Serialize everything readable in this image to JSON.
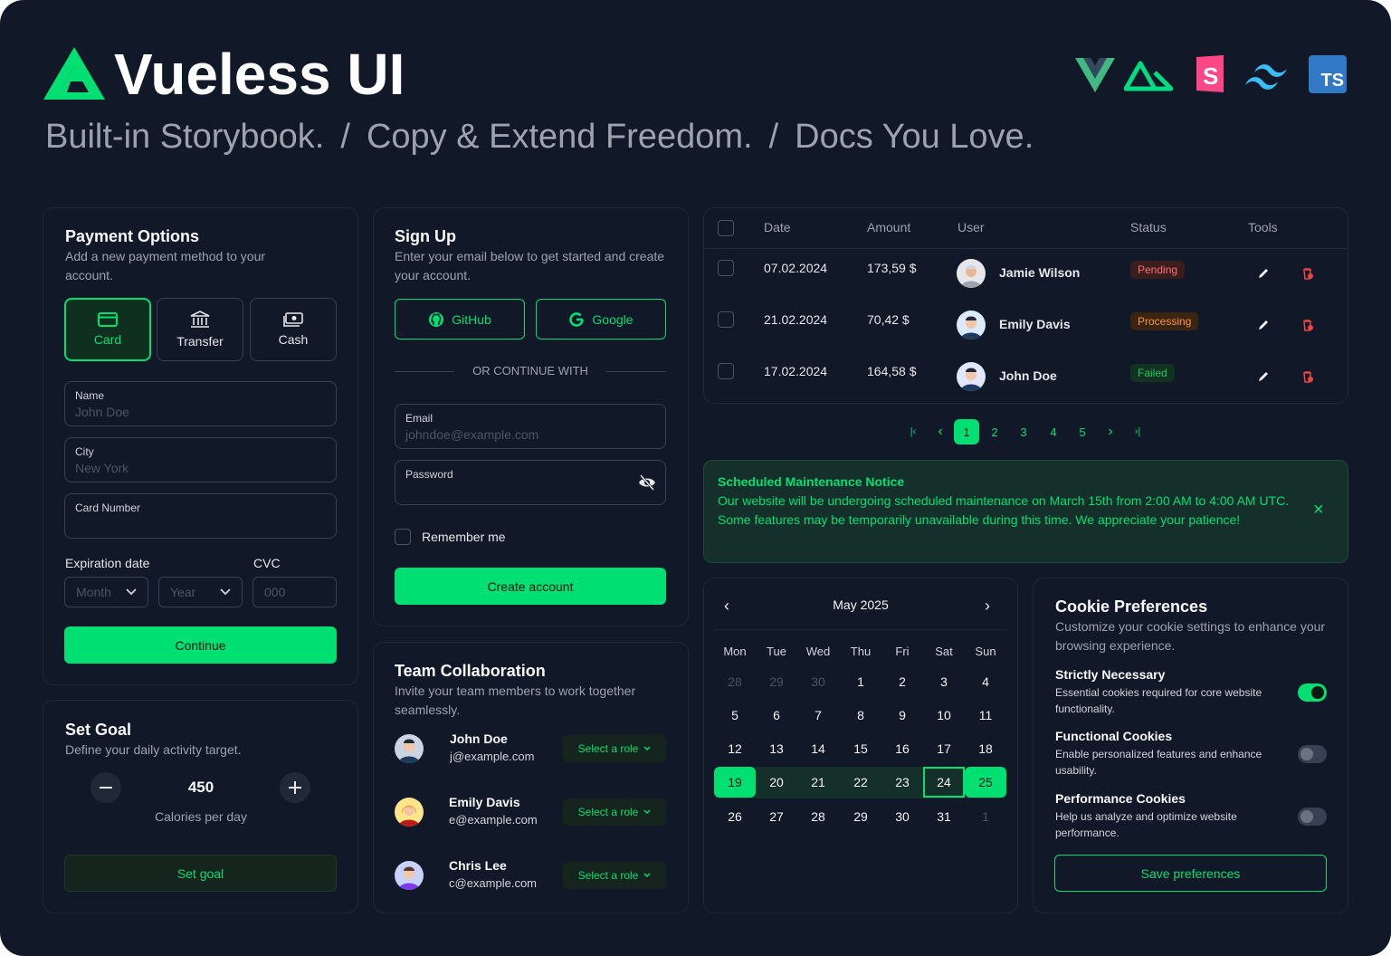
{
  "header": {
    "brand": "Vueless UI",
    "taglines": [
      "Built-in Storybook.",
      "/",
      "Copy & Extend Freedom.",
      "/",
      "Docs You Love."
    ],
    "tech_icons": [
      "vue-icon",
      "nuxt-icon",
      "storybook-icon",
      "tailwind-icon",
      "typescript-icon"
    ],
    "ts_label": "TS"
  },
  "payment": {
    "title": "Payment Options",
    "subtitle": "Add a new payment method to your account.",
    "methods": [
      {
        "label": "Card",
        "icon": "credit-card-icon",
        "active": true
      },
      {
        "label": "Transfer",
        "icon": "bank-icon",
        "active": false
      },
      {
        "label": "Cash",
        "icon": "cash-icon",
        "active": false
      }
    ],
    "name_label": "Name",
    "name_placeholder": "John Doe",
    "city_label": "City",
    "city_placeholder": "New York",
    "card_label": "Card Number",
    "card_placeholder": "",
    "exp_label": "Expiration date",
    "cvc_label": "CVC",
    "month_placeholder": "Month",
    "year_placeholder": "Year",
    "cvc_placeholder": "000",
    "continue_label": "Continue"
  },
  "goal": {
    "title": "Set Goal",
    "subtitle": "Define your daily activity target.",
    "value": "450",
    "unit": "Calories per day",
    "button": "Set goal"
  },
  "signup": {
    "title": "Sign Up",
    "subtitle": "Enter your email below to get started and create your account.",
    "github": "GitHub",
    "google": "Google",
    "divider": "OR CONTINUE WITH",
    "email_label": "Email",
    "email_placeholder": "johndoe@example.com",
    "password_label": "Password",
    "remember": "Remember me",
    "create": "Create account"
  },
  "team": {
    "title": "Team Collaboration",
    "subtitle": "Invite your team members to work together seamlessly.",
    "select_label": "Select a role",
    "members": [
      {
        "name": "John Doe",
        "email": "j@example.com"
      },
      {
        "name": "Emily Davis",
        "email": "e@example.com"
      },
      {
        "name": "Chris Lee",
        "email": "c@example.com"
      }
    ]
  },
  "table": {
    "headers": {
      "date": "Date",
      "amount": "Amount",
      "user": "User",
      "status": "Status",
      "tools": "Tools"
    },
    "rows": [
      {
        "date": "07.02.2024",
        "amount": "173,59 $",
        "user": "Jamie Wilson",
        "status": "Pending",
        "status_color": "#f87171"
      },
      {
        "date": "21.02.2024",
        "amount": "70,42 $",
        "user": "Emily Davis",
        "status": "Processing",
        "status_color": "#fb923c"
      },
      {
        "date": "17.02.2024",
        "amount": "164,58 $",
        "user": "John Doe",
        "status": "Failed",
        "status_color": "#22c55e"
      }
    ]
  },
  "pagination": {
    "first": "|‹",
    "prev": "‹",
    "next": "›",
    "last": "›|",
    "pages": [
      "1",
      "2",
      "3",
      "4",
      "5"
    ],
    "current": "1"
  },
  "notice": {
    "title": "Scheduled Maintenance Notice",
    "body": "Our website will be undergoing scheduled maintenance on March 15th from 2:00 AM to 4:00 AM UTC. Some features may be temporarily unavailable during this time. We appreciate your patience!",
    "close": "×"
  },
  "calendar": {
    "month": "May 2025",
    "weekdays": [
      "Mon",
      "Tue",
      "Wed",
      "Thu",
      "Fri",
      "Sat",
      "Sun"
    ],
    "weeks": [
      [
        "28",
        "29",
        "30",
        "1",
        "2",
        "3",
        "4"
      ],
      [
        "5",
        "6",
        "7",
        "8",
        "9",
        "10",
        "11"
      ],
      [
        "12",
        "13",
        "14",
        "15",
        "16",
        "17",
        "18"
      ],
      [
        "19",
        "20",
        "21",
        "22",
        "23",
        "24",
        "25"
      ],
      [
        "26",
        "27",
        "28",
        "29",
        "30",
        "31",
        "1"
      ]
    ],
    "range_start": "19",
    "range_end": "25",
    "today": "24"
  },
  "cookies": {
    "title": "Cookie Preferences",
    "subtitle": "Customize your cookie settings to enhance your browsing experience.",
    "items": [
      {
        "title": "Strictly Necessary",
        "desc": "Essential cookies required for core website functionality.",
        "on": true
      },
      {
        "title": "Functional Cookies",
        "desc": "Enable personalized features and enhance usability.",
        "on": false
      },
      {
        "title": "Performance Cookies",
        "desc": "Help us analyze and optimize website performance.",
        "on": false
      }
    ],
    "save": "Save preferences"
  },
  "colors": {
    "accent": "#00df72",
    "background": "#111827",
    "border": "#1f2937"
  }
}
